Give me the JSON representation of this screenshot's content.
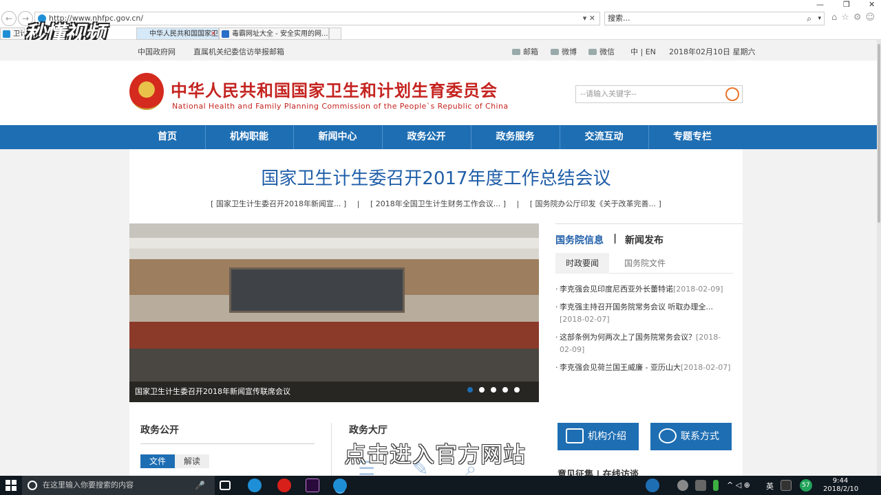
{
  "browser": {
    "back": "←",
    "forward": "→",
    "url": "http://www.nhfpc.gov.cn/",
    "url_controls": "▾ ✕",
    "search_placeholder": "搜索...",
    "search_icon": "⌕",
    "search_dropdown": "▾",
    "toolbar_icons": "⌂☆⚙☺",
    "win_min": "—",
    "win_max": "❐",
    "win_close": "✕",
    "tabs": [
      {
        "label": "卫计委",
        "color": "#1e8fd6"
      },
      {
        "label": "中华人民共和国国家卫生和...",
        "color": "#1e8fd6"
      },
      {
        "label": "毒霸网址大全 - 安全实用的网...",
        "color": "#2a6fc9"
      }
    ],
    "tab_close": "✕",
    "watermark": "秒懂视频"
  },
  "topbar": {
    "link_gov": "中国政府网",
    "link_report": "直属机关纪委信访举报邮箱",
    "mail": "邮箱",
    "weibo": "微博",
    "wechat": "微信",
    "lang": "中 | EN",
    "date": "2018年02月10日 星期六"
  },
  "header": {
    "title_cn": "中华人民共和国国家卫生和计划生育委员会",
    "title_en": "National Health and Family Planning Commission of the People`s Republic of China",
    "search_placeholder": "--请输入关键字--"
  },
  "nav": [
    "首页",
    "机构职能",
    "新闻中心",
    "政务公开",
    "政务服务",
    "交流互动",
    "专题专栏"
  ],
  "main": {
    "headline": "国家卫生计生委召开2017年度工作总结会议",
    "sublinks": [
      "[ 国家卫生计生委召开2018年新闻宣... ]",
      "|",
      "[ 2018年全国卫生计生财务工作会议... ]",
      "|",
      "[ 国务院办公厅印发《关于改革完善... ]"
    ],
    "slider_caption": "国家卫生计生委召开2018年新闻宣传联席会议"
  },
  "news": {
    "tab1": "国务院信息",
    "sep": "|",
    "tab2": "新闻发布",
    "subtab_active": "时政要闻",
    "subtab_other": "国务院文件",
    "items": [
      {
        "text": "李克强会见印度尼西亚外长蕾特诺",
        "date": "[2018-02-09]"
      },
      {
        "text": "李克强主持召开国务院常务会议 听取办理全...",
        "date": "[2018-02-07]"
      },
      {
        "text": "这部条例为何两次上了国务院常务会议？",
        "date": "[2018-02-09]"
      },
      {
        "text": "李克强会见荷兰国王威廉 - 亚历山大",
        "date": "[2018-02-07]"
      }
    ]
  },
  "sections": {
    "gov_open": "政务公开",
    "btn_file": "文件",
    "btn_explain": "解读",
    "gov_hall": "政务大厅",
    "mid_icons": "☰✎⌕",
    "org_intro": "机构介绍",
    "contact": "联系方式",
    "opinion": "意见征集 | 在线访谈",
    "overlay": "点击进入官方网站"
  },
  "taskbar": {
    "search_placeholder": "在这里输入你要搜索的内容",
    "mic": "🎤",
    "tray_icons": "^ ◁ ⊕",
    "ime": "英",
    "badge": "57",
    "time": "9:44",
    "date": "2018/2/10"
  },
  "colors": {
    "brand_blue": "#1e6eb3",
    "brand_red": "#c4231f",
    "headline_blue": "#1f5ea8"
  }
}
